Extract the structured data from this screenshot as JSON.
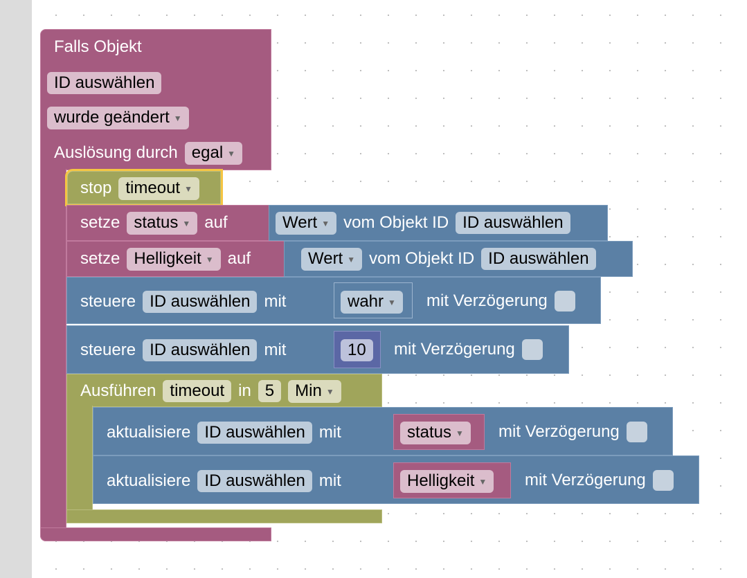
{
  "colors": {
    "event": "#a55b80",
    "action": "#5b80a5",
    "timer": "#a0a55b",
    "number": "#5b67a5",
    "selected": "#f5c542"
  },
  "trigger": {
    "title": "Falls Objekt",
    "id": "ID auswählen",
    "condition": "wurde geändert",
    "trigger_label": "Auslösung durch",
    "trigger_value": "egal"
  },
  "stop": {
    "label": "stop",
    "value": "timeout"
  },
  "set1": {
    "label": "setze",
    "var": "status",
    "auf": "auf",
    "value": "Wert",
    "from": "vom Objekt ID",
    "id": "ID auswählen"
  },
  "set2": {
    "label": "setze",
    "var": "Helligkeit",
    "auf": "auf",
    "value": "Wert",
    "from": "vom Objekt ID",
    "id": "ID auswählen"
  },
  "control1": {
    "label": "steuere",
    "id": "ID auswählen",
    "mit": "mit",
    "value": "wahr",
    "delay": "mit Verzögerung"
  },
  "control2": {
    "label": "steuere",
    "id": "ID auswählen",
    "mit": "mit",
    "value": "10",
    "delay": "mit Verzögerung"
  },
  "timeout": {
    "label": "Ausführen",
    "name": "timeout",
    "in": "in",
    "amount": "5",
    "unit": "Min"
  },
  "update1": {
    "label": "aktualisiere",
    "id": "ID auswählen",
    "mit": "mit",
    "var": "status",
    "delay": "mit Verzögerung"
  },
  "update2": {
    "label": "aktualisiere",
    "id": "ID auswählen",
    "mit": "mit",
    "var": "Helligkeit",
    "delay": "mit Verzögerung"
  }
}
